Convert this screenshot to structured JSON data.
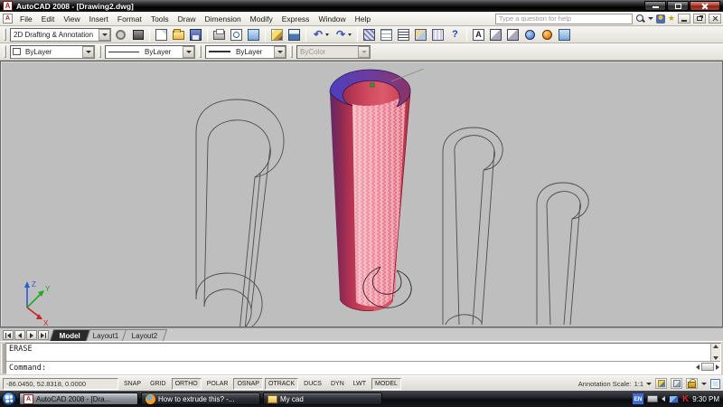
{
  "titlebar": {
    "title": "AutoCAD 2008 - [Drawing2.dwg]"
  },
  "menubar": {
    "items": [
      "File",
      "Edit",
      "View",
      "Insert",
      "Format",
      "Tools",
      "Draw",
      "Dimension",
      "Modify",
      "Express",
      "Window",
      "Help"
    ],
    "help_search": {
      "placeholder": "Type a question for help"
    }
  },
  "toolbars": {
    "workspace_dropdown": "2D Drafting & Annotation",
    "properties": {
      "color": "ByLayer",
      "linetype": "ByLayer",
      "lineweight": "ByLayer",
      "plot_style": "ByColor"
    }
  },
  "icons": {
    "search": "css-magnifier",
    "new_file": "css-page",
    "open": "css-folder",
    "save": "css-floppy",
    "plot": "css-printer",
    "undo": "curved-arrow-left",
    "redo": "curved-arrow-right",
    "help": "question-mark",
    "render": "orange-sphere",
    "web": "blue-globe",
    "lock": "gold-padlock"
  },
  "icon_glyphs": {
    "autocad_a": "A",
    "undo": "↶",
    "redo": "↷",
    "help": "?",
    "star": "★",
    "text_style": "A",
    "kaspersky": "K"
  },
  "canvas": {
    "ucs": {
      "x": "X",
      "y": "Y",
      "z": "Z"
    }
  },
  "layout_tabs": {
    "items": [
      "Model",
      "Layout1",
      "Layout2"
    ],
    "active": "Model"
  },
  "command_window": {
    "history_lines": [
      "ERASE",
      ""
    ],
    "prompt": "Command:"
  },
  "status_bar": {
    "coordinates": "-86.0450, 52.8318, 0.0000",
    "toggles": [
      {
        "label": "SNAP",
        "active": false
      },
      {
        "label": "GRID",
        "active": false
      },
      {
        "label": "ORTHO",
        "active": true
      },
      {
        "label": "POLAR",
        "active": false
      },
      {
        "label": "OSNAP",
        "active": true
      },
      {
        "label": "OTRACK",
        "active": true
      },
      {
        "label": "DUCS",
        "active": false
      },
      {
        "label": "DYN",
        "active": false
      },
      {
        "label": "LWT",
        "active": false
      },
      {
        "label": "MODEL",
        "active": true
      }
    ],
    "annotation_scale": {
      "label": "Annotation Scale:",
      "value": "1:1"
    }
  },
  "taskbar": {
    "buttons": [
      {
        "label": "AutoCAD 2008 - [Dra...",
        "active": true
      },
      {
        "label": "How to extrude this? -...",
        "active": false
      },
      {
        "label": "My cad",
        "active": false
      }
    ],
    "tray": {
      "language": "EN",
      "clock": "9:30 PM"
    }
  },
  "colors": {
    "canvas_gray": "#bdbebd",
    "selection_red": "#d14a60",
    "selection_purple": "#6e3c9e",
    "hatch_white": "#ffffff",
    "ucs_x": "#cc2222",
    "ucs_y": "#22aa22",
    "ucs_z": "#2a5ad8"
  }
}
